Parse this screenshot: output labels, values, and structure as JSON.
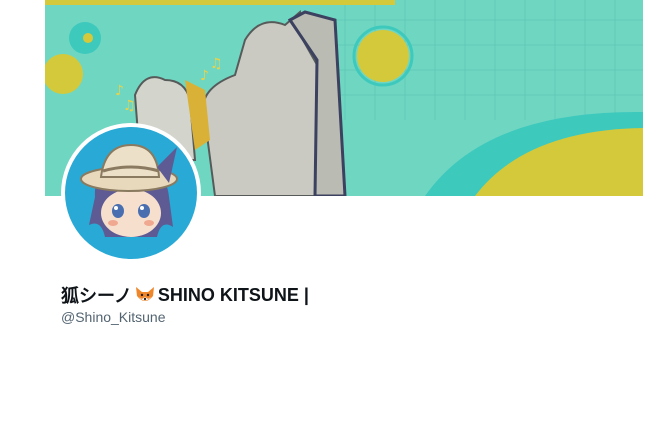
{
  "profile": {
    "display_name_prefix": "狐シーノ",
    "display_name_emoji": "fox-face-icon",
    "display_name_suffix": "SHINO KITSUNE |",
    "handle": "@Shino_Kitsune"
  },
  "colors": {
    "banner_bg": "#6fd6c2",
    "banner_teal": "#3ec9bd",
    "banner_yellow": "#d4c93a",
    "avatar_bg": "#29a9d6",
    "text_primary": "#0f1419",
    "text_secondary": "#536471"
  }
}
